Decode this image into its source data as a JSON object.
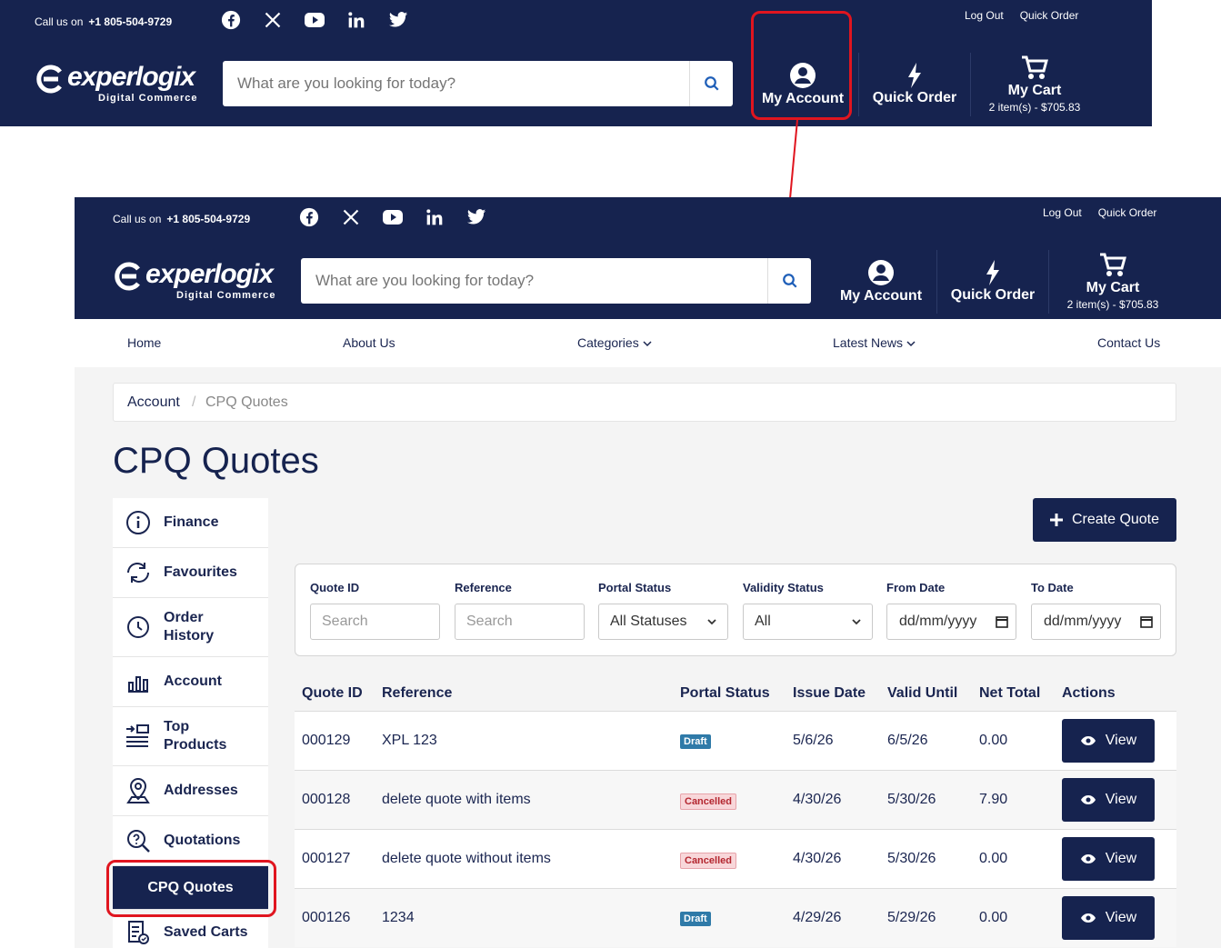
{
  "header": {
    "call_label": "Call us on",
    "phone": "+1 805-504-9729",
    "top_links": [
      "Log Out",
      "Quick Order"
    ],
    "brand": "experlogix",
    "brand_sub": "Digital Commerce",
    "search_placeholder": "What are you looking for today?",
    "nav": {
      "account": "My Account",
      "quick_order": "Quick Order",
      "cart": "My Cart",
      "cart_count": "2 item(s) - $705.83"
    },
    "social_icons": [
      "facebook-icon",
      "x-icon",
      "youtube-icon",
      "linkedin-icon",
      "twitter-icon"
    ]
  },
  "menu": [
    "Home",
    "About Us",
    "Categories",
    "Latest News",
    "Contact Us"
  ],
  "breadcrumb": {
    "parent": "Account",
    "separator": "/",
    "current": "CPQ Quotes"
  },
  "page_title": "CPQ Quotes",
  "sidebar": [
    {
      "label": "Finance",
      "icon": "info-icon"
    },
    {
      "label": "Favourites",
      "icon": "refresh-icon"
    },
    {
      "label": "Order History",
      "icon": "history-icon"
    },
    {
      "label": "Account",
      "icon": "chart-icon"
    },
    {
      "label": "Top Products",
      "icon": "list-icon"
    },
    {
      "label": "Addresses",
      "icon": "location-icon"
    },
    {
      "label": "Quotations",
      "icon": "question-search-icon"
    },
    {
      "label": "CPQ Quotes",
      "icon": "",
      "active": true
    },
    {
      "label": "Saved Carts",
      "icon": "saved-list-icon"
    }
  ],
  "create_button": "Create Quote",
  "filters": {
    "quote_id": {
      "label": "Quote ID",
      "placeholder": "Search"
    },
    "reference": {
      "label": "Reference",
      "placeholder": "Search"
    },
    "portal_status": {
      "label": "Portal Status",
      "value": "All Statuses"
    },
    "validity_status": {
      "label": "Validity Status",
      "value": "All"
    },
    "from_date": {
      "label": "From Date",
      "placeholder": "dd/mm/yyyy"
    },
    "to_date": {
      "label": "To Date",
      "placeholder": "dd/mm/yyyy"
    }
  },
  "table": {
    "headers": [
      "Quote ID",
      "Reference",
      "Portal Status",
      "Issue Date",
      "Valid Until",
      "Net Total",
      "Actions"
    ],
    "view_label": "View",
    "rows": [
      {
        "id": "000129",
        "reference": "XPL 123",
        "status": "Draft",
        "issue": "5/6/26",
        "valid": "6/5/26",
        "total": "0.00"
      },
      {
        "id": "000128",
        "reference": "delete quote with items",
        "status": "Cancelled",
        "issue": "4/30/26",
        "valid": "5/30/26",
        "total": "7.90"
      },
      {
        "id": "000127",
        "reference": "delete quote without items",
        "status": "Cancelled",
        "issue": "4/30/26",
        "valid": "5/30/26",
        "total": "0.00"
      },
      {
        "id": "000126",
        "reference": "1234",
        "status": "Draft",
        "issue": "4/29/26",
        "valid": "5/29/26",
        "total": "0.00"
      }
    ]
  },
  "colors": {
    "navy": "#16234f",
    "highlight": "#e0151f",
    "draft": "#2f7aa8",
    "cancelled": "#b3262f"
  }
}
